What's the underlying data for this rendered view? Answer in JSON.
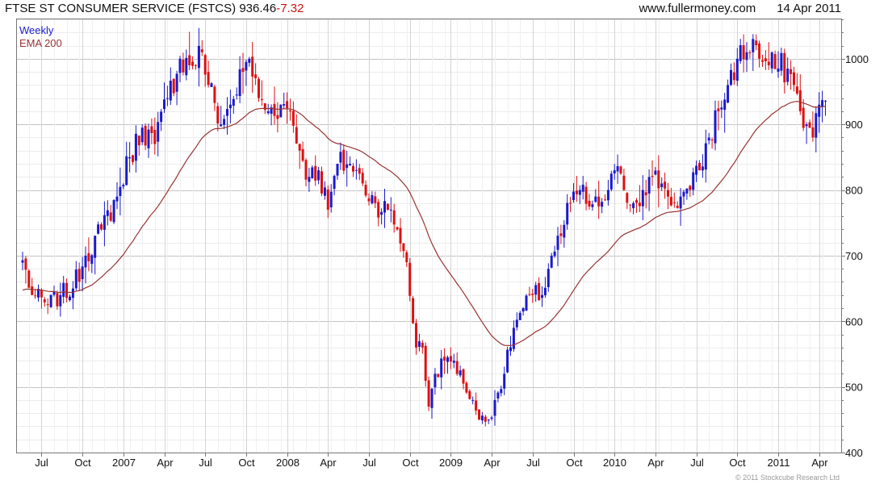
{
  "header": {
    "title": "FTSE ST CONSUMER SERVICE (FSTCS)",
    "last": "936.46",
    "change": "-7.32",
    "site": "www.fullermoney.com",
    "date": "14 Apr 2011"
  },
  "legend": {
    "period": "Weekly",
    "ema": "EMA 200"
  },
  "copyright": "© 2011 Stockcube Research Ltd",
  "colors": {
    "up": "#1a1acc",
    "down": "#dd1111",
    "ema": "#993333",
    "grid": "#d8d8d8"
  },
  "chart_data": {
    "type": "candlestick",
    "interval": "weekly",
    "ylim": [
      400,
      1060
    ],
    "y_ticks": [
      400,
      500,
      600,
      700,
      800,
      900,
      1000
    ],
    "x_ticks": [
      {
        "label": "Jul",
        "w": 6
      },
      {
        "label": "Oct",
        "w": 19
      },
      {
        "label": "2007",
        "w": 32
      },
      {
        "label": "Apr",
        "w": 45
      },
      {
        "label": "Jul",
        "w": 58
      },
      {
        "label": "Oct",
        "w": 71
      },
      {
        "label": "2008",
        "w": 84
      },
      {
        "label": "Apr",
        "w": 97
      },
      {
        "label": "Jul",
        "w": 110
      },
      {
        "label": "Oct",
        "w": 123
      },
      {
        "label": "2009",
        "w": 136
      },
      {
        "label": "Apr",
        "w": 149
      },
      {
        "label": "Jul",
        "w": 162
      },
      {
        "label": "Oct",
        "w": 175
      },
      {
        "label": "2010",
        "w": 188
      },
      {
        "label": "Apr",
        "w": 201
      },
      {
        "label": "Jul",
        "w": 214
      },
      {
        "label": "Oct",
        "w": 227
      },
      {
        "label": "2011",
        "w": 240
      },
      {
        "label": "Apr",
        "w": 253
      }
    ],
    "key_closes": [
      [
        0,
        693
      ],
      [
        3,
        640
      ],
      [
        8,
        625
      ],
      [
        12,
        640
      ],
      [
        16,
        650
      ],
      [
        20,
        700
      ],
      [
        25,
        740
      ],
      [
        30,
        790
      ],
      [
        34,
        850
      ],
      [
        38,
        895
      ],
      [
        42,
        870
      ],
      [
        46,
        940
      ],
      [
        50,
        1000
      ],
      [
        53,
        990
      ],
      [
        57,
        1010
      ],
      [
        59,
        960
      ],
      [
        63,
        900
      ],
      [
        66,
        930
      ],
      [
        70,
        980
      ],
      [
        72,
        1000
      ],
      [
        75,
        940
      ],
      [
        78,
        920
      ],
      [
        82,
        930
      ],
      [
        85,
        920
      ],
      [
        88,
        860
      ],
      [
        91,
        820
      ],
      [
        94,
        830
      ],
      [
        97,
        770
      ],
      [
        100,
        840
      ],
      [
        104,
        840
      ],
      [
        108,
        810
      ],
      [
        112,
        780
      ],
      [
        116,
        770
      ],
      [
        119,
        740
      ],
      [
        122,
        690
      ],
      [
        125,
        560
      ],
      [
        127,
        560
      ],
      [
        129,
        470
      ],
      [
        131,
        520
      ],
      [
        134,
        540
      ],
      [
        137,
        540
      ],
      [
        140,
        505
      ],
      [
        143,
        480
      ],
      [
        145,
        450
      ],
      [
        148,
        450
      ],
      [
        150,
        480
      ],
      [
        153,
        520
      ],
      [
        156,
        590
      ],
      [
        159,
        620
      ],
      [
        162,
        640
      ],
      [
        165,
        640
      ],
      [
        168,
        700
      ],
      [
        171,
        730
      ],
      [
        174,
        780
      ],
      [
        177,
        800
      ],
      [
        180,
        775
      ],
      [
        183,
        775
      ],
      [
        186,
        800
      ],
      [
        188,
        830
      ],
      [
        191,
        800
      ],
      [
        194,
        780
      ],
      [
        197,
        800
      ],
      [
        200,
        820
      ],
      [
        203,
        810
      ],
      [
        205,
        790
      ],
      [
        207,
        780
      ],
      [
        209,
        790
      ],
      [
        212,
        800
      ],
      [
        215,
        830
      ],
      [
        218,
        880
      ],
      [
        221,
        920
      ],
      [
        224,
        960
      ],
      [
        227,
        1000
      ],
      [
        230,
        1010
      ],
      [
        232,
        1030
      ],
      [
        234,
        1000
      ],
      [
        237,
        990
      ],
      [
        240,
        985
      ],
      [
        243,
        985
      ],
      [
        245,
        960
      ],
      [
        247,
        920
      ],
      [
        249,
        900
      ],
      [
        251,
        880
      ],
      [
        253,
        930
      ],
      [
        255,
        936
      ]
    ]
  }
}
